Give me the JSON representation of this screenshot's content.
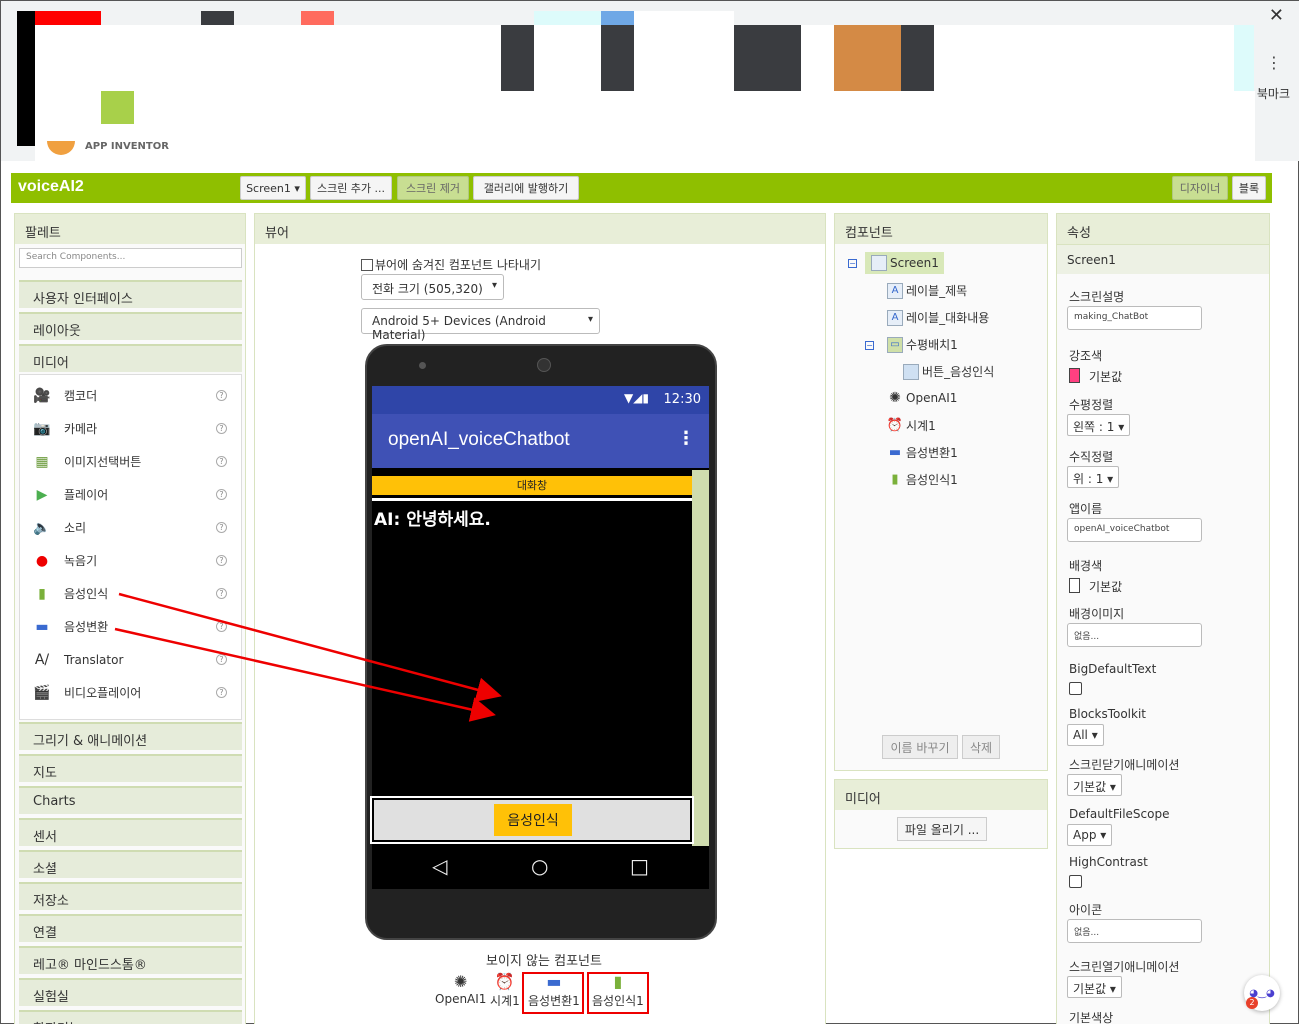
{
  "chrome": {
    "close_glyph": "✕",
    "kebab_glyph": "⋮",
    "bookmark_label": "북마크",
    "logo_label": "APP INVENTOR"
  },
  "header": {
    "project_name": "voiceAI2",
    "screen_select": "Screen1 ▾",
    "add_screen": "스크린 추가 ...",
    "remove_screen": "스크린 제거",
    "publish_gallery": "갤러리에 발행하기",
    "designer": "디자이너",
    "blocks": "블록"
  },
  "palette": {
    "title": "팔레트",
    "search_placeholder": "Search Components...",
    "categories_top": [
      "사용자 인터페이스",
      "레이아웃",
      "미디어"
    ],
    "media_items": [
      {
        "label": "캠코더",
        "icon": "camcorder-icon"
      },
      {
        "label": "카메라",
        "icon": "camera-icon"
      },
      {
        "label": "이미지선택버튼",
        "icon": "image-picker-icon"
      },
      {
        "label": "플레이어",
        "icon": "play-icon"
      },
      {
        "label": "소리",
        "icon": "speaker-icon"
      },
      {
        "label": "녹음기",
        "icon": "record-icon"
      },
      {
        "label": "음성인식",
        "icon": "microphone-icon"
      },
      {
        "label": "음성변환",
        "icon": "speech-bubble-icon"
      },
      {
        "label": "Translator",
        "icon": "translator-icon"
      },
      {
        "label": "비디오플레이어",
        "icon": "video-icon"
      }
    ],
    "help_glyph": "?",
    "categories_bottom": [
      "그리기 & 애니메이션",
      "지도",
      "Charts",
      "센서",
      "소셜",
      "저장소",
      "연결",
      "레고® 마인드스톰®",
      "실험실",
      "확장기능"
    ]
  },
  "viewer": {
    "title": "뷰어",
    "show_hidden": "뷰어에 숨겨진 컴포넌트 나타내기",
    "size_select": "전화 크기 (505,320)",
    "theme_select": "Android 5+ Devices (Android Material)",
    "phone": {
      "time": "12:30",
      "status_icons": "▼◢▮",
      "app_title": "openAI_voiceChatbot",
      "menu": "⋮",
      "label_title": "대화창",
      "chat_text": "AI: 안녕하세요.",
      "voice_button": "음성인식",
      "nav_back": "◁",
      "nav_home": "○",
      "nav_recent": "□"
    },
    "nonvisible_title": "보이지 않는 컴포넌트",
    "nonvisible": [
      {
        "label": "OpenAI1",
        "icon": "openai-icon"
      },
      {
        "label": "시계1",
        "icon": "clock-icon"
      },
      {
        "label": "음성변환1",
        "icon": "speech-bubble-icon"
      },
      {
        "label": "음성인식1",
        "icon": "microphone-icon"
      }
    ]
  },
  "components": {
    "title": "컴포넌트",
    "tree": [
      {
        "label": "Screen1",
        "icon": "screen-icon"
      },
      {
        "label": "레이블_제목",
        "icon": "label-icon"
      },
      {
        "label": "레이블_대화내용",
        "icon": "label-icon"
      },
      {
        "label": "수평배치1",
        "icon": "horizontal-arrangement-icon"
      },
      {
        "label": "버튼_음성인식",
        "icon": "button-icon"
      },
      {
        "label": "OpenAI1",
        "icon": "openai-icon"
      },
      {
        "label": "시계1",
        "icon": "clock-icon"
      },
      {
        "label": "음성변환1",
        "icon": "speech-bubble-icon"
      },
      {
        "label": "음성인식1",
        "icon": "microphone-icon"
      }
    ],
    "collapse_glyph": "−",
    "rename": "이름 바꾸기",
    "delete": "삭제",
    "media_title": "미디어",
    "upload": "파일 올리기 ..."
  },
  "properties": {
    "title": "속성",
    "component": "Screen1",
    "screen_desc_label": "스크린설명",
    "screen_desc_value": "making_ChatBot",
    "accent_label": "강조색",
    "accent_value": "기본값",
    "accent_color": "#ff4081",
    "halign_label": "수평정렬",
    "halign_value": "왼쪽 : 1 ▾",
    "valign_label": "수직정렬",
    "valign_value": "위 : 1 ▾",
    "appname_label": "앱이름",
    "appname_value": "openAI_voiceChatbot",
    "bgcolor_label": "배경색",
    "bgcolor_value": "기본값",
    "bgimage_label": "배경이미지",
    "bgimage_value": "없음...",
    "bigtext_label": "BigDefaultText",
    "blocks_toolkit_label": "BlocksToolkit",
    "blocks_toolkit_value": "All ▾",
    "close_anim_label": "스크린닫기애니메이션",
    "close_anim_value": "기본값 ▾",
    "filescope_label": "DefaultFileScope",
    "filescope_value": "App ▾",
    "contrast_label": "HighContrast",
    "icon_label": "아이콘",
    "icon_value": "없음...",
    "open_anim_label": "스크린열기애니메이션",
    "open_anim_value": "기본값 ▾",
    "primary_color_label": "기본색상"
  },
  "assistant": {
    "badge": "2",
    "glyph": "◕‿◕"
  },
  "colors": {
    "brand_green": "#8fbf00",
    "appbar_blue": "#3f51b5",
    "button_yellow": "#ffc107",
    "annotation_red": "#e00000"
  }
}
